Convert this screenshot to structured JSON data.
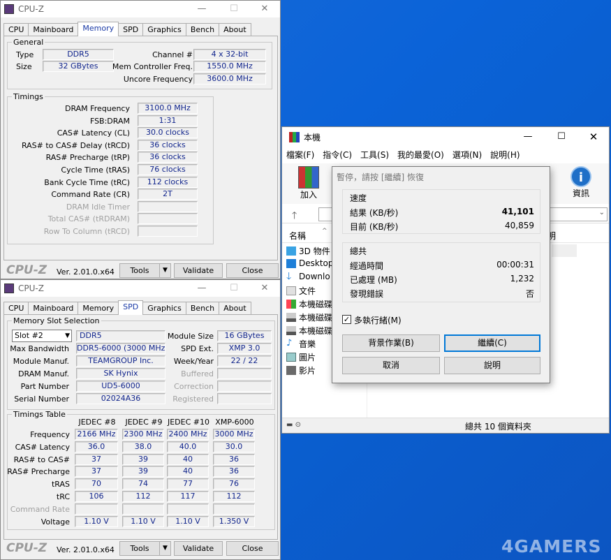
{
  "cpuz1": {
    "title": "CPU-Z",
    "tabs": [
      "CPU",
      "Mainboard",
      "Memory",
      "SPD",
      "Graphics",
      "Bench",
      "About"
    ],
    "general_label": "General",
    "type_label": "Type",
    "type": "DDR5",
    "size_label": "Size",
    "size": "32 GBytes",
    "channel_label": "Channel #",
    "channel": "4 x 32-bit",
    "mcf_label": "Mem Controller Freq.",
    "mcf": "1550.0 MHz",
    "uncore_label": "Uncore Frequency",
    "uncore": "3600.0 MHz",
    "timings_label": "Timings",
    "timings": [
      {
        "label": "DRAM Frequency",
        "value": "3100.0 MHz"
      },
      {
        "label": "FSB:DRAM",
        "value": "1:31"
      },
      {
        "label": "CAS# Latency (CL)",
        "value": "30.0 clocks"
      },
      {
        "label": "RAS# to CAS# Delay (tRCD)",
        "value": "36 clocks"
      },
      {
        "label": "RAS# Precharge (tRP)",
        "value": "36 clocks"
      },
      {
        "label": "Cycle Time (tRAS)",
        "value": "76 clocks"
      },
      {
        "label": "Bank Cycle Time (tRC)",
        "value": "112 clocks"
      },
      {
        "label": "Command Rate (CR)",
        "value": "2T"
      },
      {
        "label": "DRAM Idle Timer",
        "value": ""
      },
      {
        "label": "Total CAS# (tRDRAM)",
        "value": ""
      },
      {
        "label": "Row To Column (tRCD)",
        "value": ""
      }
    ],
    "logo": "CPU-Z",
    "version": "Ver. 2.01.0.x64",
    "tools": "Tools",
    "validate": "Validate",
    "close": "Close"
  },
  "cpuz2": {
    "title": "CPU-Z",
    "tabs": [
      "CPU",
      "Mainboard",
      "Memory",
      "SPD",
      "Graphics",
      "Bench",
      "About"
    ],
    "slot_group": "Memory Slot Selection",
    "slot": "Slot #2",
    "slot_type": "DDR5",
    "module_size_label": "Module Size",
    "module_size": "16 GBytes",
    "max_bw_label": "Max Bandwidth",
    "max_bw": "DDR5-6000 (3000 MHz)",
    "spd_ext_label": "SPD Ext.",
    "spd_ext": "XMP 3.0",
    "module_manuf_label": "Module Manuf.",
    "module_manuf": "TEAMGROUP Inc.",
    "week_year_label": "Week/Year",
    "week_year": "22 / 22",
    "dram_manuf_label": "DRAM Manuf.",
    "dram_manuf": "SK Hynix",
    "buffered_label": "Buffered",
    "part_label": "Part Number",
    "part": "UD5-6000",
    "correction_label": "Correction",
    "serial_label": "Serial Number",
    "serial": "02024A36",
    "registered_label": "Registered",
    "timings_table_label": "Timings Table",
    "columns": [
      "JEDEC #8",
      "JEDEC #9",
      "JEDEC #10",
      "XMP-6000"
    ],
    "rows": [
      {
        "label": "Frequency",
        "values": [
          "2166 MHz",
          "2300 MHz",
          "2400 MHz",
          "3000 MHz"
        ]
      },
      {
        "label": "CAS# Latency",
        "values": [
          "36.0",
          "38.0",
          "40.0",
          "30.0"
        ]
      },
      {
        "label": "RAS# to CAS#",
        "values": [
          "37",
          "39",
          "40",
          "36"
        ]
      },
      {
        "label": "RAS# Precharge",
        "values": [
          "37",
          "39",
          "40",
          "36"
        ]
      },
      {
        "label": "tRAS",
        "values": [
          "70",
          "74",
          "77",
          "76"
        ]
      },
      {
        "label": "tRC",
        "values": [
          "106",
          "112",
          "117",
          "112"
        ]
      },
      {
        "label": "Command Rate",
        "values": [
          "",
          "",
          "",
          ""
        ]
      },
      {
        "label": "Voltage",
        "values": [
          "1.10 V",
          "1.10 V",
          "1.10 V",
          "1.350 V"
        ]
      }
    ],
    "logo": "CPU-Z",
    "version": "Ver. 2.01.0.x64",
    "tools": "Tools",
    "validate": "Validate",
    "close": "Close"
  },
  "explorer": {
    "title": "本機",
    "menu": [
      "檔案(F)",
      "指令(C)",
      "工具(S)",
      "我的最愛(O)",
      "選項(N)",
      "說明(H)"
    ],
    "add": "加入",
    "info": "資訊",
    "name_col": "名稱",
    "size_col_partial": "明",
    "items": [
      "3D 物件",
      "Desktop",
      "Downlo",
      "文件",
      "本機磁碟",
      "本機磁碟",
      "本機磁碟",
      "音樂",
      "圖片",
      "影片"
    ],
    "status": "總共 10 個資料夾"
  },
  "dialog": {
    "title": "暫停，請按 [繼續] 恢復",
    "speed_label": "速度",
    "result_label": "結果 (KB/秒)",
    "result": "41,101",
    "current_label": "目前 (KB/秒)",
    "current": "40,859",
    "total_label": "總共",
    "elapsed_label": "經過時間",
    "elapsed": "00:00:31",
    "processed_label": "已處理 (MB)",
    "processed": "1,232",
    "errors_label": "發現錯誤",
    "errors": "否",
    "multithread_label": "多執行緒(M)",
    "background": "背景作業(B)",
    "continue": "繼續(C)",
    "cancel": "取消",
    "help": "說明"
  },
  "watermark": "4GAMERS"
}
